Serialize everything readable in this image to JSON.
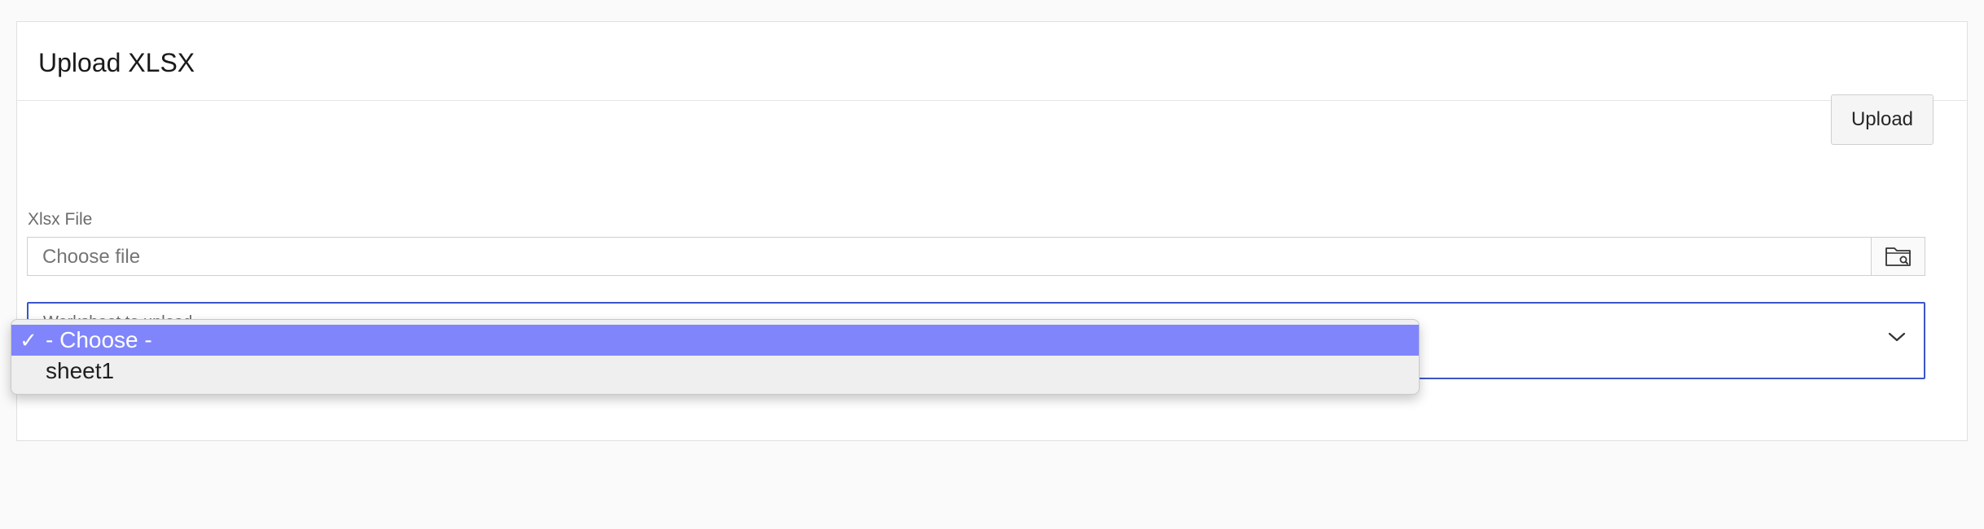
{
  "region": {
    "title": "Upload XLSX"
  },
  "toolbar": {
    "upload_label": "Upload"
  },
  "xlsx_file": {
    "label": "Xlsx File",
    "placeholder": "Choose file",
    "browse_icon": "folder-search-icon"
  },
  "worksheet": {
    "label": "Worksheet to upload",
    "chevron_icon": "chevron-down-icon",
    "options": [
      {
        "label": "- Choose -",
        "selected": true,
        "check": "✓"
      },
      {
        "label": "sheet1",
        "selected": false,
        "check": ""
      }
    ]
  },
  "colors": {
    "accent_border": "#3b56c7",
    "option_highlight": "#8085fb"
  }
}
